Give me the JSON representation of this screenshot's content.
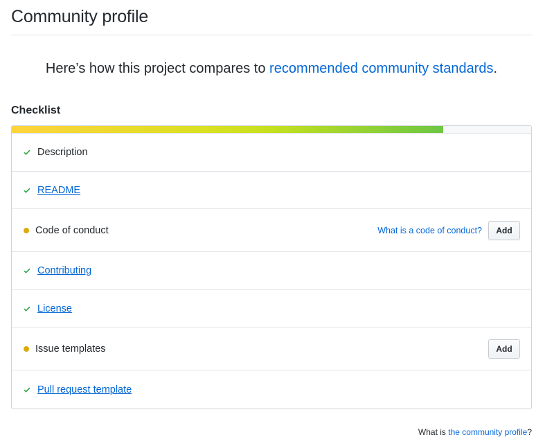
{
  "page": {
    "title": "Community profile",
    "intro_prefix": "Here’s how this project compares to ",
    "intro_link": "recommended community standards",
    "intro_suffix": "."
  },
  "checklist": {
    "heading": "Checklist",
    "progress_fraction": 0.83,
    "colors": {
      "check": "#28a745",
      "pending_dot": "#dbab09",
      "link": "#0366d6"
    },
    "items": [
      {
        "label": "Description",
        "status": "done",
        "is_link": false
      },
      {
        "label": "README",
        "status": "done",
        "is_link": true
      },
      {
        "label": "Code of conduct",
        "status": "pending",
        "is_link": false,
        "help_link": "What is a code of conduct?",
        "action": "Add"
      },
      {
        "label": "Contributing",
        "status": "done",
        "is_link": true
      },
      {
        "label": "License",
        "status": "done",
        "is_link": true
      },
      {
        "label": "Issue templates",
        "status": "pending",
        "is_link": false,
        "action": "Add"
      },
      {
        "label": "Pull request template",
        "status": "done",
        "is_link": true
      }
    ]
  },
  "footer": {
    "prefix": "What is ",
    "link": "the community profile",
    "suffix": "?"
  }
}
